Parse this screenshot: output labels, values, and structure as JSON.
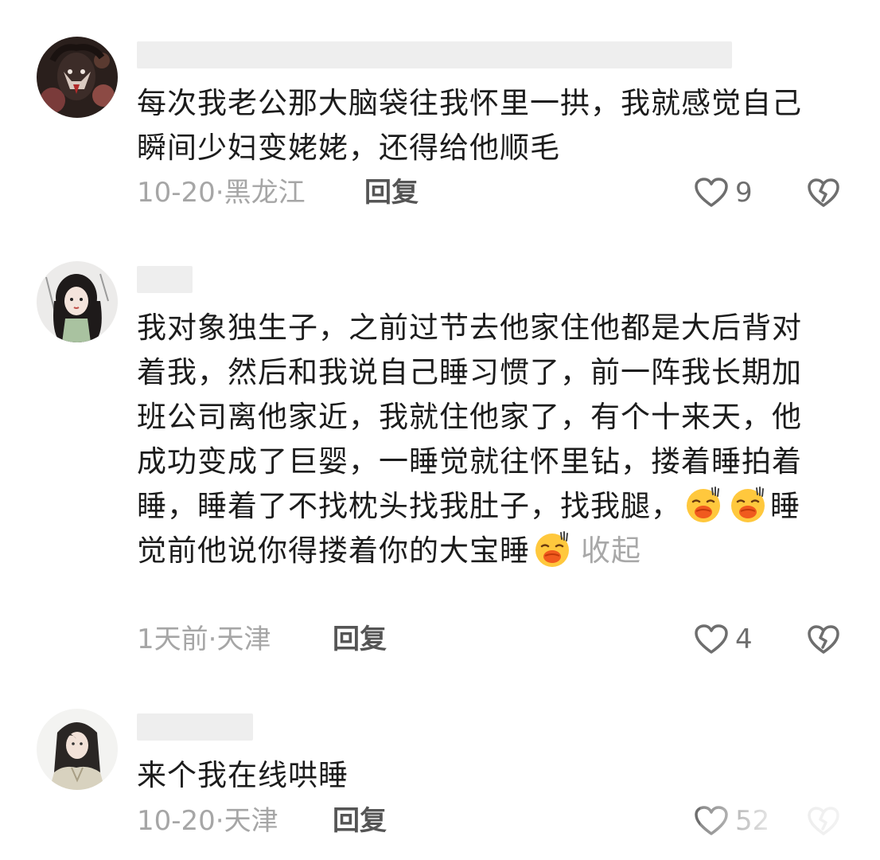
{
  "comments": [
    {
      "text": "每次我老公那大脑袋往我怀里一拱，我就感觉自己瞬间少妇变姥姥，还得给他顺毛",
      "date": "10-20",
      "location": "黑龙江",
      "reply_label": "回复",
      "like_count": "9",
      "avatar_icon": "dark-horror-art-avatar"
    },
    {
      "text_part1": "我对象独生子，之前过节去他家住他都是大后背对着我，然后和我说自己睡习惯了，前一阵我长期加班公司离他家近，我就住他家了，有个十来天，他成功变成了巨婴，一睡觉就往怀里钻，搂着睡拍着睡，睡着了不找枕头找我肚子，找我腿，",
      "text_part2": "睡觉前他说你得搂着你的大宝睡",
      "collapse_label": "收起",
      "date": "1天前",
      "location": "天津",
      "reply_label": "回复",
      "like_count": "4",
      "avatar_icon": "anime-girl-avatar",
      "emoji_icon": "kiss-face-emoji"
    },
    {
      "text": "来个我在线哄睡",
      "date": "10-20",
      "location": "天津",
      "reply_label": "回复",
      "like_count": "52",
      "avatar_icon": "anime-girl-robe-avatar"
    }
  ],
  "meta_separator": "·",
  "colors": {
    "text": "#1c1c1c",
    "meta": "#a6a6a6",
    "reply": "#555555",
    "redaction": "#eeeeee"
  }
}
